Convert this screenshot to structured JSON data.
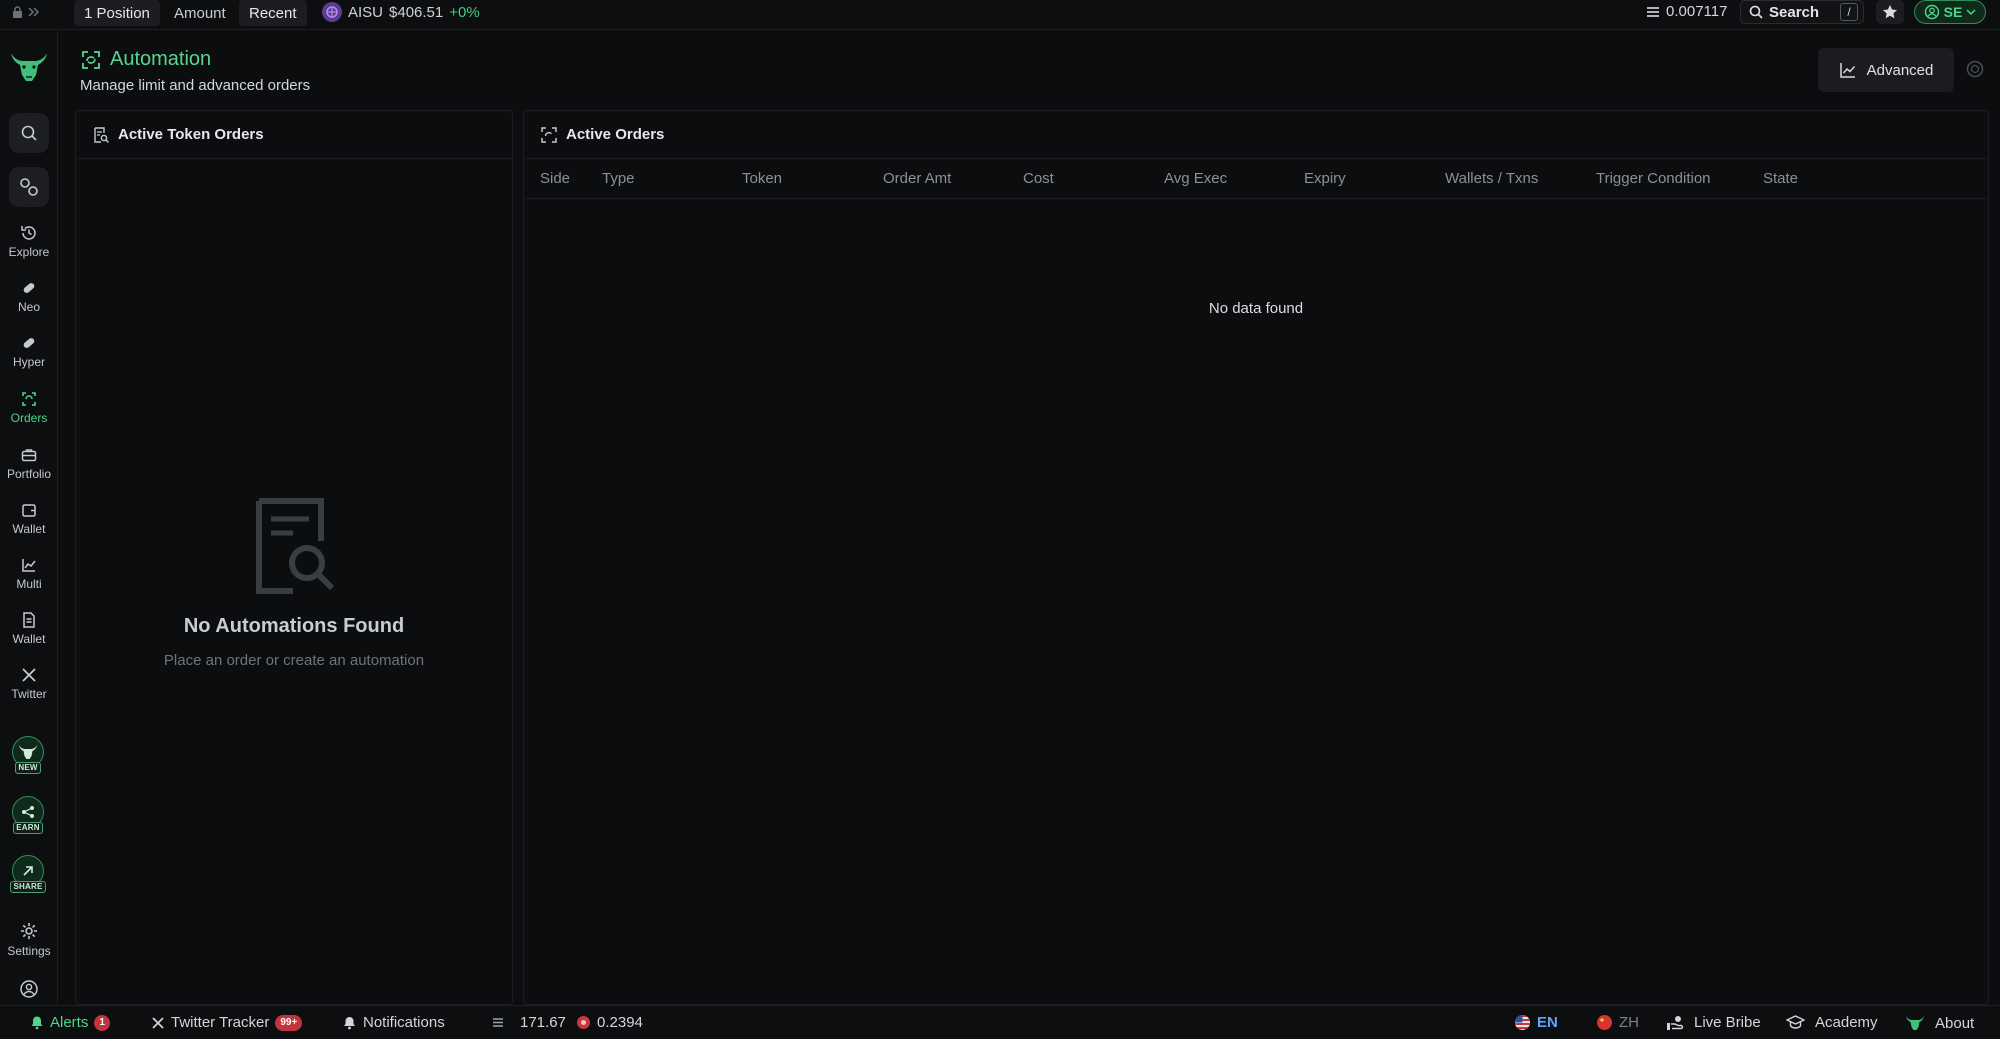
{
  "topbar": {
    "tabs": [
      {
        "label": "1 Position",
        "active": true
      },
      {
        "label": "Amount",
        "active": false
      },
      {
        "label": "Recent",
        "active": true
      }
    ],
    "ticker": {
      "symbol": "AISU",
      "price": "$406.51",
      "change": "+0%"
    },
    "balance": "0.007117",
    "search_label": "Search",
    "search_shortcut": "/",
    "user_initials": "SE"
  },
  "sidebar": {
    "items": [
      {
        "label": "Explore",
        "icon": "history-icon"
      },
      {
        "label": "Neo",
        "icon": "pill-icon"
      },
      {
        "label": "Hyper",
        "icon": "pill-icon"
      },
      {
        "label": "Orders",
        "icon": "automation-icon",
        "active": true
      },
      {
        "label": "Portfolio",
        "icon": "briefcase-icon"
      },
      {
        "label": "Wallet",
        "icon": "wallet-icon"
      },
      {
        "label": "Multi",
        "icon": "chart-icon"
      },
      {
        "label": "Wallet",
        "icon": "document-icon"
      },
      {
        "label": "Twitter",
        "icon": "x-icon"
      }
    ],
    "badges": [
      "NEW",
      "EARN",
      "SHARE"
    ],
    "settings_label": "Settings"
  },
  "page": {
    "title": "Automation",
    "subtitle": "Manage limit and advanced orders",
    "advanced_label": "Advanced"
  },
  "left_panel": {
    "title": "Active Token Orders",
    "empty_title": "No Automations Found",
    "empty_sub": "Place an order or create an automation"
  },
  "right_panel": {
    "title": "Active Orders",
    "columns": [
      "Side",
      "Type",
      "Token",
      "Order Amt",
      "Cost",
      "Avg Exec",
      "Expiry",
      "Wallets / Txns",
      "Trigger Condition",
      "State"
    ],
    "empty": "No data found"
  },
  "bottombar": {
    "alerts_label": "Alerts",
    "alerts_count": "1",
    "twitter_label": "Twitter Tracker",
    "twitter_count": "99+",
    "notifications_label": "Notifications",
    "stat1": "171.67",
    "stat2": "0.2394",
    "lang_en": "EN",
    "lang_zh": "ZH",
    "live_bribe": "Live Bribe",
    "academy": "Academy",
    "about": "About"
  },
  "colors": {
    "accent": "#4fd48a",
    "background": "#0c0d0f",
    "panel_border": "#1c1e22",
    "alert_red": "#c0353d"
  }
}
